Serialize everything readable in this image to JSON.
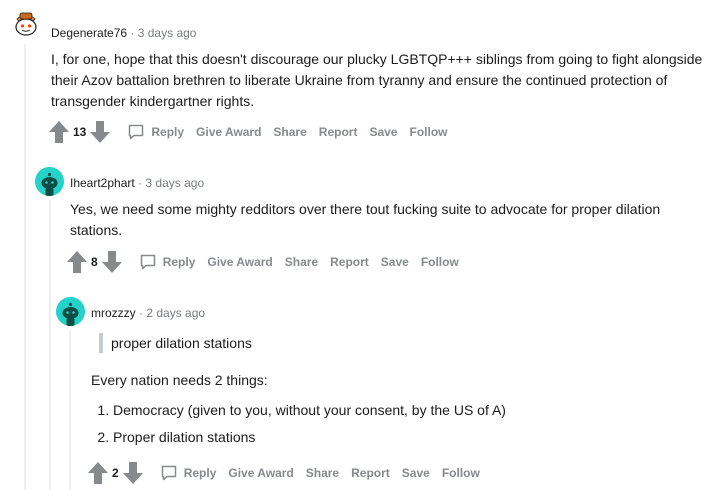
{
  "comments": [
    {
      "username": "Degenerate76",
      "separator": "·",
      "time": "3 days ago",
      "body": "I, for one, hope that this doesn't discourage our plucky LGBTQP+++ siblings from going to fight alongside their Azov battalion brethren to liberate Ukraine from tyranny and ensure the continued protection of transgender kindergartner rights.",
      "score": "13"
    },
    {
      "username": "Iheart2phart",
      "separator": "·",
      "time": "3 days ago",
      "body": "Yes, we need some mighty redditors over there tout fucking suite to advocate for proper dilation stations.",
      "score": "8"
    },
    {
      "username": "mrozzzy",
      "separator": "·",
      "time": "2 days ago",
      "quote": "proper dilation stations",
      "intro": "Every nation needs 2 things:",
      "list": [
        "Democracy (given to you, without your consent, by the US of A)",
        "Proper dilation stations"
      ],
      "score": "2"
    }
  ],
  "actions": {
    "reply": "Reply",
    "give_award": "Give Award",
    "share": "Share",
    "report": "Report",
    "save": "Save",
    "follow": "Follow"
  },
  "colors": {
    "upvote_gray": "#878a8c",
    "avatar_teal": "#24d2c9",
    "avatar_snoo_dark": "#0d4d43",
    "thread_line": "#edeff1"
  },
  "icons": {
    "upvote": "arrow-up-icon",
    "downvote": "arrow-down-icon",
    "reply": "speech-bubble-icon",
    "avatar": "snoo-icon"
  }
}
